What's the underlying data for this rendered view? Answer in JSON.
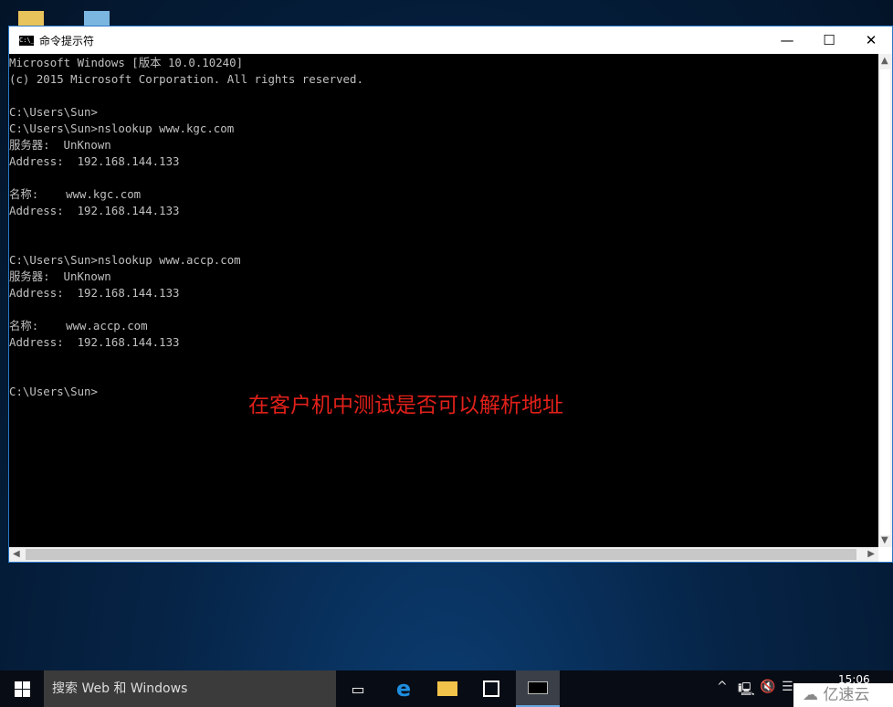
{
  "window": {
    "title": "命令提示符",
    "icon": "cmd-icon",
    "controls": [
      "minimize",
      "maximize",
      "close"
    ]
  },
  "console": {
    "lines": [
      "Microsoft Windows [版本 10.0.10240]",
      "(c) 2015 Microsoft Corporation. All rights reserved.",
      "",
      "C:\\Users\\Sun>",
      "C:\\Users\\Sun>nslookup www.kgc.com",
      "服务器:  UnKnown",
      "Address:  192.168.144.133",
      "",
      "名称:    www.kgc.com",
      "Address:  192.168.144.133",
      "",
      "",
      "C:\\Users\\Sun>nslookup www.accp.com",
      "服务器:  UnKnown",
      "Address:  192.168.144.133",
      "",
      "名称:    www.accp.com",
      "Address:  192.168.144.133",
      "",
      "",
      "C:\\Users\\Sun>"
    ]
  },
  "annotation": "在客户机中测试是否可以解析地址",
  "annotation_color": "#e0201a",
  "taskbar": {
    "search_placeholder": "搜索 Web 和 Windows",
    "clock": "15:06"
  },
  "watermark": "亿速云"
}
